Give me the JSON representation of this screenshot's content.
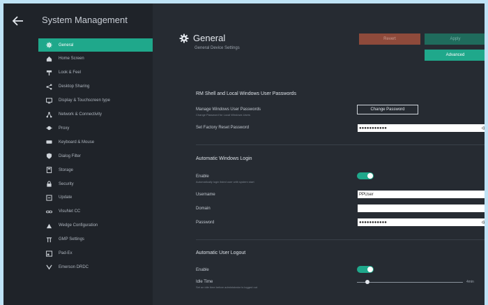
{
  "app": {
    "title": "System Management"
  },
  "sidebar": {
    "items": [
      {
        "label": "General",
        "icon": "gear-icon",
        "active": true
      },
      {
        "label": "Home Screen",
        "icon": "home-icon"
      },
      {
        "label": "Look & Feel",
        "icon": "paint-roller-icon"
      },
      {
        "label": "Desktop Sharing",
        "icon": "share-icon"
      },
      {
        "label": "Display & Touchscreen type",
        "icon": "monitor-icon"
      },
      {
        "label": "Network & Connectivity",
        "icon": "network-icon"
      },
      {
        "label": "Proxy",
        "icon": "proxy-icon"
      },
      {
        "label": "Keyboard & Mouse",
        "icon": "keyboard-icon"
      },
      {
        "label": "Dialog Filter",
        "icon": "filter-icon"
      },
      {
        "label": "Storage",
        "icon": "storage-icon"
      },
      {
        "label": "Security",
        "icon": "lock-icon"
      },
      {
        "label": "Update",
        "icon": "update-icon"
      },
      {
        "label": "VisuNet CC",
        "icon": "link-icon"
      },
      {
        "label": "Wedge Configuration",
        "icon": "wedge-icon"
      },
      {
        "label": "GMP Settings",
        "icon": "gmp-icon"
      },
      {
        "label": "Pad-Ex",
        "icon": "padex-icon"
      },
      {
        "label": "Emerson DRDC",
        "icon": "emerson-icon"
      }
    ]
  },
  "page": {
    "title": "General",
    "subtitle": "General Device Settings"
  },
  "toolbar": {
    "revert_label": "Revert",
    "apply_label": "Apply",
    "advanced_label": "Advanced"
  },
  "sections": {
    "passwords": {
      "title": "RM Shell and Local Windows User Passwords",
      "manage_label": "Manage Windows User Passwords",
      "manage_hint": "Change Password for Local Windows Users",
      "change_button": "Change Password",
      "factory_label": "Set Factory Reset Password",
      "factory_value": "●●●●●●●●●●●"
    },
    "autologin": {
      "title": "Automatic Windows Login",
      "enable_label": "Enable",
      "enable_hint": "Automatically login listed user with system start",
      "enabled": true,
      "username_label": "Username",
      "username_value": "PPUser",
      "domain_label": "Domain",
      "domain_value": "",
      "password_label": "Password",
      "password_value": "●●●●●●●●●●●"
    },
    "logout": {
      "title": "Automatic User Logout",
      "enable_label": "Enable",
      "enabled": true,
      "idle_label": "Idle Time",
      "idle_hint": "Set an idle time before administrator is logged out",
      "idle_value": "4min",
      "idle_fraction": 0.1
    }
  },
  "colors": {
    "accent": "#1fa88b",
    "background": "#262b32",
    "sidebar": "#1f2329",
    "revert": "#8e4a3b"
  }
}
